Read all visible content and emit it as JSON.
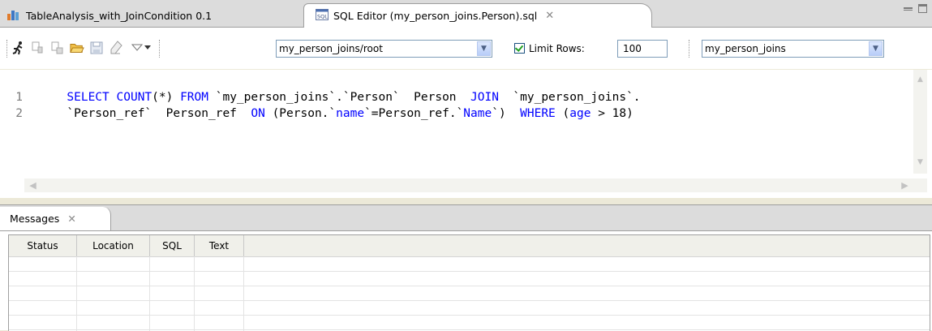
{
  "tabs": {
    "inactive": {
      "label": "TableAnalysis_with_JoinCondition 0.1",
      "icon": "table-analysis-icon"
    },
    "active": {
      "label": "SQL Editor (my_person_joins.Person).sql",
      "icon": "sql-file-icon",
      "close_glyph": "✕"
    }
  },
  "toolbar": {
    "connection": "my_person_joins/root",
    "limit_rows_label": "Limit Rows:",
    "limit_rows_checked": true,
    "limit_rows_value": "100",
    "database": "my_person_joins"
  },
  "editor": {
    "line_numbers": [
      "1",
      "2"
    ],
    "line1": {
      "kw1": "SELECT COUNT",
      "t1": "(*) ",
      "kw2": "FROM",
      "t2": " `my_person_joins`.`Person`  Person  ",
      "kw3": "JOIN",
      "t3": "  `my_person_joins`."
    },
    "line2": {
      "t1": "`Person_ref`  Person_ref  ",
      "kw1": "ON",
      "t2": " (Person.`",
      "id1": "name",
      "t3": "`=Person_ref.`",
      "id2": "Name",
      "t4": "`)  ",
      "kw2": "WHERE",
      "t5": " (",
      "id3": "age",
      "t6": " > 18)"
    }
  },
  "messages": {
    "tab_label": "Messages",
    "close_glyph": "✕",
    "columns": [
      "Status",
      "Location",
      "SQL",
      "Text"
    ]
  },
  "colors": {
    "keyword": "#0000ff",
    "identifier": "#0000ff",
    "line_number": "#7b7b7b",
    "checkbox_check": "#21a121"
  }
}
